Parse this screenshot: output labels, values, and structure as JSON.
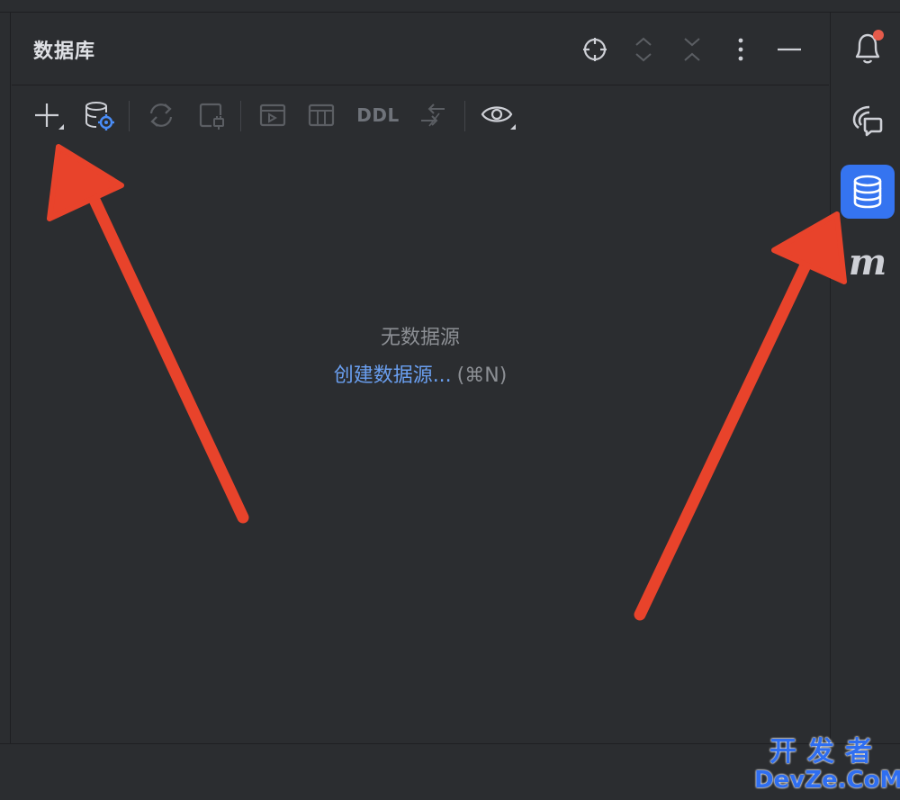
{
  "panel": {
    "title": "数据库"
  },
  "header_buttons": [
    {
      "name": "locate-icon"
    },
    {
      "name": "expand-all-icon"
    },
    {
      "name": "collapse-all-icon"
    },
    {
      "name": "more-options-icon"
    },
    {
      "name": "minimize-icon"
    }
  ],
  "toolbar": {
    "ddl_label": "DDL"
  },
  "empty_state": {
    "title": "无数据源",
    "action_label": "创建数据源...",
    "shortcut": "(⌘N)"
  },
  "right_stripe": {
    "items": [
      {
        "name": "notifications-icon",
        "active": false
      },
      {
        "name": "ai-chat-icon",
        "active": false
      },
      {
        "name": "database-icon",
        "active": true
      },
      {
        "name": "maven-icon",
        "label": "m",
        "active": false
      }
    ]
  },
  "colors": {
    "background": "#2b2d30",
    "accent": "#3574f0",
    "link": "#6a9ff0",
    "annotation_arrow": "#e8432b",
    "notification_badge": "#e55b4b"
  },
  "watermark": {
    "line1": "开发者",
    "line2": "DevZe.CoM"
  }
}
